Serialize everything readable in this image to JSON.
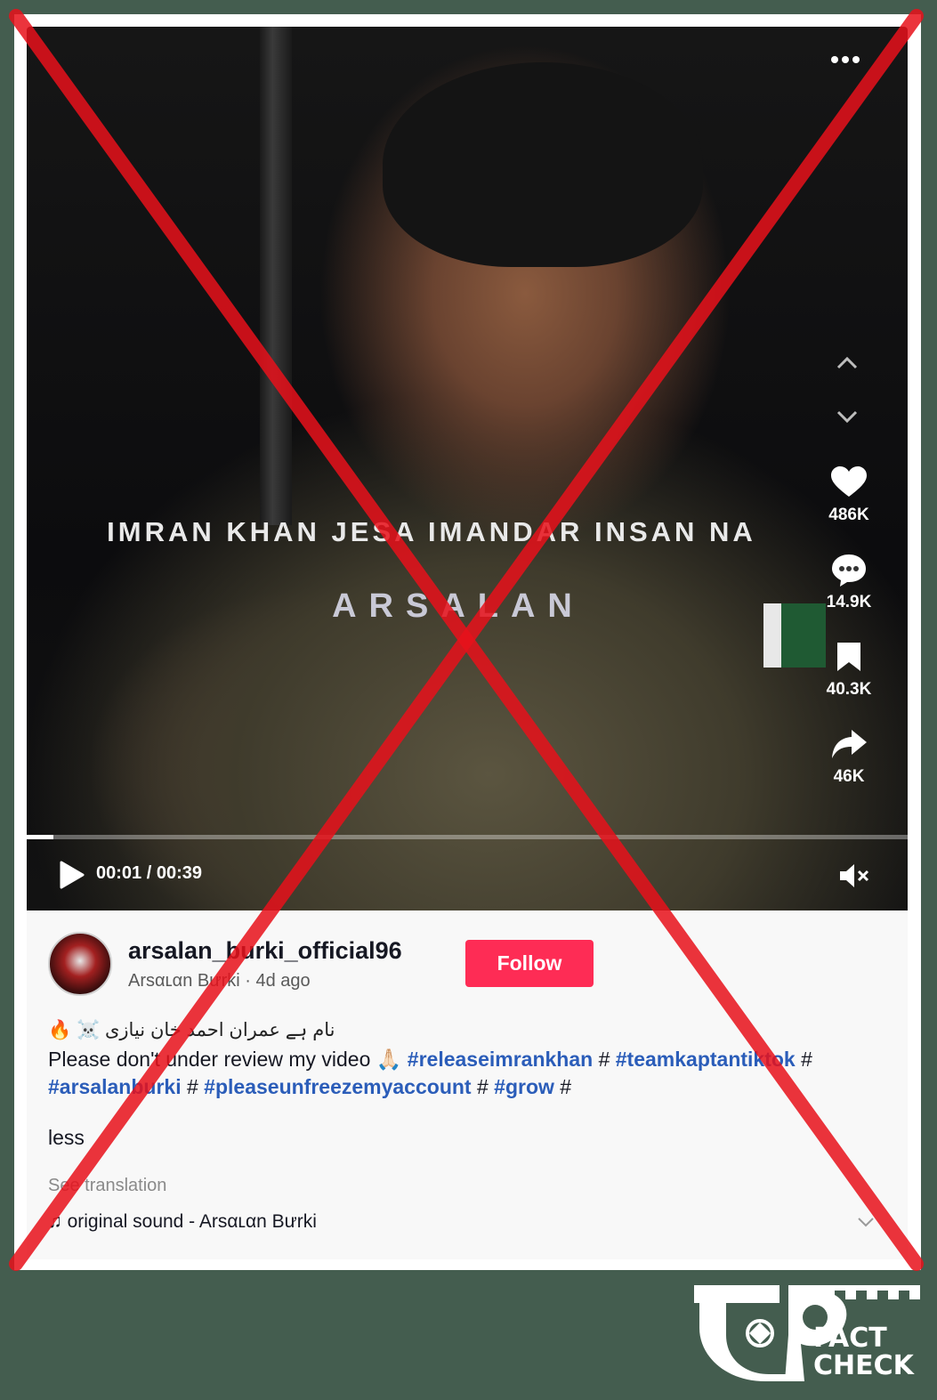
{
  "video": {
    "overlay_caption": "IMRAN KHAN JESA IMANDAR INSAN NA",
    "watermark": "ARSALAN",
    "more_icon": "more-horizontal-icon",
    "counts": {
      "likes": "486K",
      "comments": "14.9K",
      "saves": "40.3K",
      "shares": "46K"
    },
    "time": "00:01 / 00:39",
    "progress": 0.03,
    "muted": true
  },
  "post": {
    "username": "arsalan_burki_official96",
    "display_name": "Arsαʟαn Bưrki",
    "age": "4d ago",
    "follow_label": "Follow",
    "urdu_line": "نام ہے عمران احمد خان نیازی ☠️ 🔥",
    "description_text": "Please don't under review my video 🙏🏻",
    "hashtags": {
      "t1": "#releaseimrankhan",
      "t2": "#teamkaptantiktok",
      "t3": "#arsalanburki",
      "t4": "#pleaseunfreezemyaccount",
      "t5": "#grow"
    },
    "hash_sep": "#",
    "less_label": "less",
    "see_translation": "See translation",
    "sound": "original sound - Arsαʟαn Bưrki"
  },
  "overlay": {
    "x_color": "#e8111b"
  },
  "branding": {
    "logo_text_1": "FACT",
    "logo_text_2": "CHECK"
  }
}
